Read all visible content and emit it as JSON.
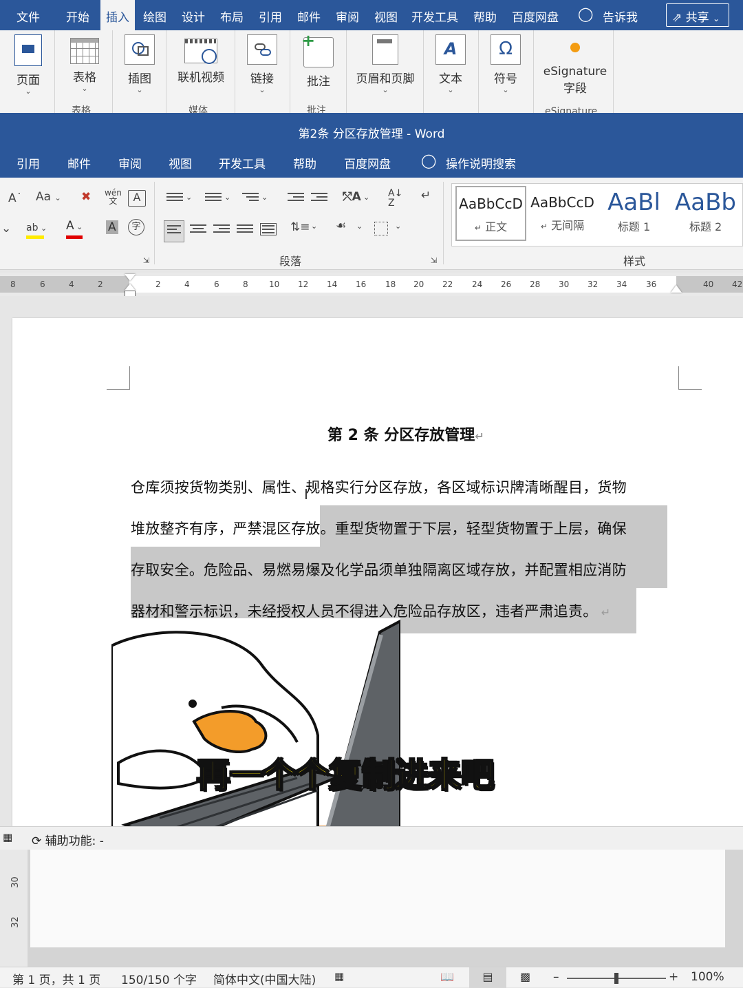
{
  "menu": {
    "tabs": [
      "文件",
      "开始",
      "插入",
      "绘图",
      "设计",
      "布局",
      "引用",
      "邮件",
      "审阅",
      "视图",
      "开发工具",
      "帮助",
      "百度网盘"
    ],
    "active": "插入",
    "tell_me": "告诉我",
    "share": "共享"
  },
  "ribbon1": {
    "pages": "页面",
    "table": "表格",
    "table_group": "表格",
    "illustrations": "插图",
    "online_video": "联机视频",
    "media_group": "媒体",
    "link": "链接",
    "comment": "批注",
    "comment_group": "批注",
    "header_footer": "页眉和页脚",
    "text": "文本",
    "symbol": "符号",
    "esignature_line1": "eSignature",
    "esignature_line2": "字段",
    "esignature_group": "eSignature"
  },
  "window_title": "第2条 分区存放管理 - Word",
  "tabs2": [
    "引用",
    "邮件",
    "审阅",
    "视图",
    "开发工具",
    "帮助",
    "百度网盘"
  ],
  "tell_me2": "操作说明搜索",
  "ribbon2": {
    "paragraph_group": "段落",
    "styles_group": "样式",
    "font_size_label": "Aa",
    "phonetic": "wén",
    "styles": [
      {
        "sample": "AaBbCcD",
        "name": "正文"
      },
      {
        "sample": "AaBbCcD",
        "name": "无间隔"
      },
      {
        "sample": "AaBl",
        "name": "标题 1"
      },
      {
        "sample": "AaBb",
        "name": "标题 2"
      }
    ]
  },
  "ruler": {
    "left_numbers": [
      "8",
      "6",
      "4",
      "2"
    ],
    "numbers": [
      "2",
      "4",
      "6",
      "8",
      "10",
      "12",
      "14",
      "16",
      "18",
      "20",
      "22",
      "24",
      "26",
      "28",
      "30",
      "32",
      "34",
      "36",
      "40",
      "42"
    ]
  },
  "document": {
    "title": "第 2 条  分区存放管理",
    "lines": [
      "仓库须按货物类别、属性、规格实行分区存放，各区域标识牌清晰醒目，货物",
      "堆放整齐有序，严禁混区存放。重型货物置于下层，轻型货物置于上层，确保",
      "存取安全。危险品、易燃易爆及化学品须单独隔离区域存放，并配置相应消防",
      "器材和警示标识，未经授权人员不得进入危险品存放区，违者严肃追责。"
    ]
  },
  "caption": "再一个个复制进来吧",
  "accessibility": "辅助功能: -",
  "vertical_ruler": [
    "30",
    "32"
  ],
  "status": {
    "page": "第 1 页，共 1 页",
    "words": "150/150 个字",
    "language": "简体中文(中国大陆)",
    "zoom": "100%",
    "zoom_level": 0.5
  }
}
